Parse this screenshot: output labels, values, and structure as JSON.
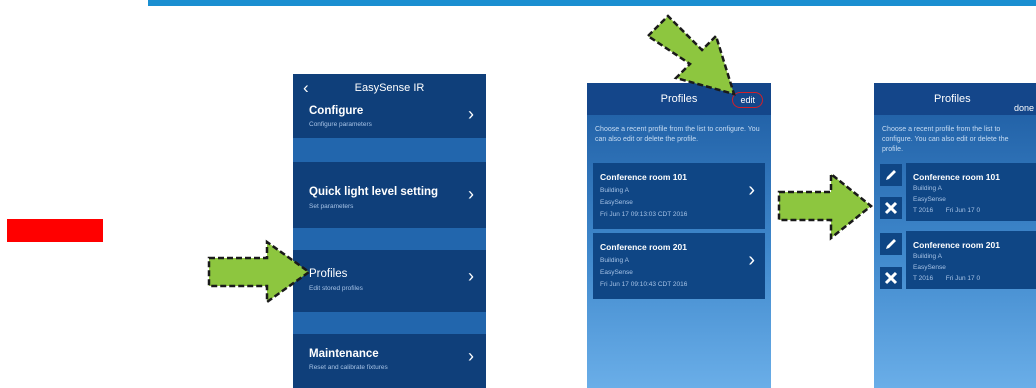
{
  "colors": {
    "accent_line": "#1a8fd1",
    "red_block": "#ff0000",
    "arrow_fill": "#8dc63f",
    "edit_circle": "#d0202a"
  },
  "screen1": {
    "title": "EasySense IR",
    "back_icon": "‹",
    "items": [
      {
        "title": "Configure",
        "subtitle": "Configure parameters"
      },
      {
        "title": "Quick light level setting",
        "subtitle": "Set parameters"
      },
      {
        "title": "Profiles",
        "subtitle": "Edit stored profiles"
      },
      {
        "title": "Maintenance",
        "subtitle": "Reset and calibrate fixtures"
      }
    ]
  },
  "screen2": {
    "title": "Profiles",
    "edit_label": "edit",
    "intro": "Choose a recent profile from the list to configure. You can also edit or delete the profile.",
    "profiles": [
      {
        "name": "Conference room 101",
        "building": "Building A",
        "device": "EasySense",
        "date": "Fri Jun 17 09:13:03 CDT 2016"
      },
      {
        "name": "Conference room 201",
        "building": "Building A",
        "device": "EasySense",
        "date": "Fri Jun 17 09:10:43 CDT 2016"
      }
    ]
  },
  "screen3": {
    "title": "Profiles",
    "done_label": "done",
    "intro": "Choose a recent profile from the list to configure. You can also edit or delete the profile.",
    "profiles": [
      {
        "name": "Conference room 101",
        "building": "Building A",
        "device": "EasySense",
        "date": "T 2016       Fri Jun 17 0"
      },
      {
        "name": "Conference room 201",
        "building": "Building A",
        "device": "EasySense",
        "date": "T 2016       Fri Jun 17 0"
      }
    ],
    "edit_icon": "pencil-icon",
    "delete_icon": "close-icon"
  }
}
